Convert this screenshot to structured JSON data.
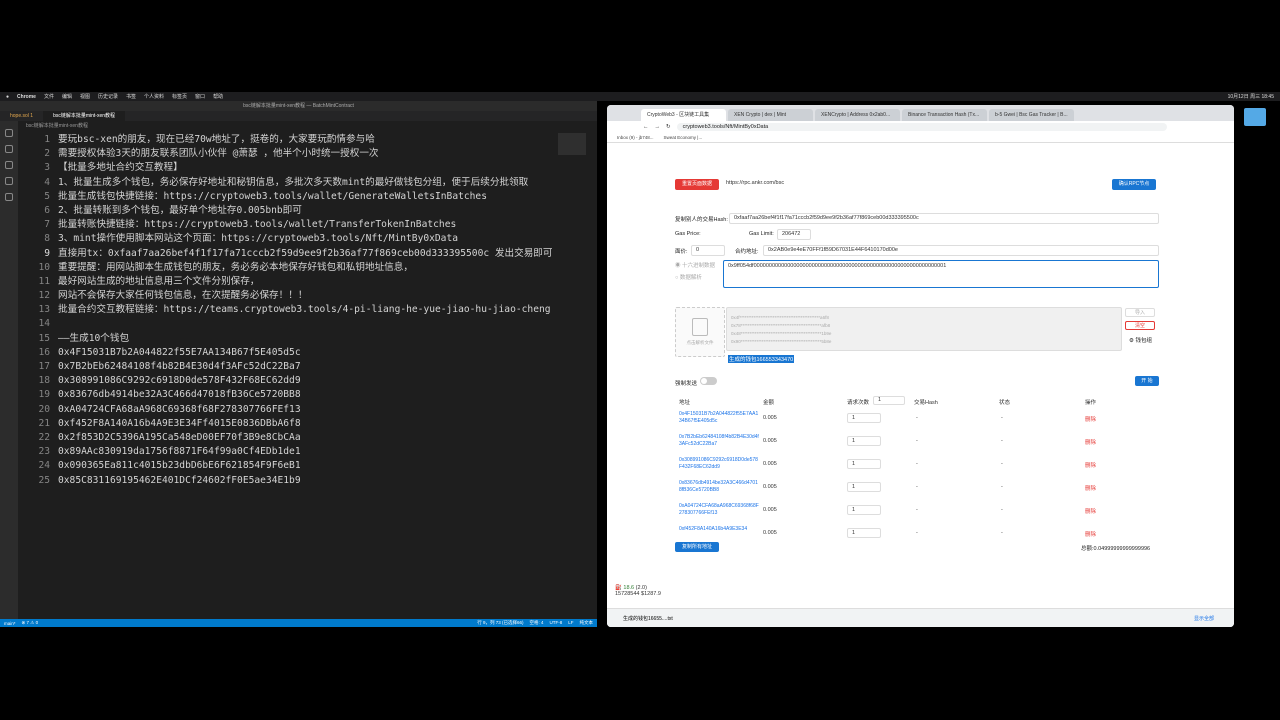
{
  "menubar": {
    "items": [
      "Chrome",
      "文件",
      "编辑",
      "视图",
      "历史记录",
      "书签",
      "个人资料",
      "标签页",
      "窗口",
      "帮助"
    ],
    "clock": "10月12日 周三 18:45"
  },
  "editor": {
    "title": "bsc链解本批量mint-xen教程 — BatchMintContract",
    "tabs": [
      "hope.sol 1",
      "bsc链解本批量mint-xen教程"
    ],
    "breadcrumb": "bsc链解本批量mint-xen教程",
    "lines": [
      "要玩bsc-xen的朋友，现在已经70w地址了，挺卷的，大家要玩酌情参与哈",
      "需要授权体验3天的朋友联系团队小伙伴 @萧瑟 ，他半个小时统一授权一次",
      "【批量多地址合约交互教程】",
      "1、批量生成多个钱包，务必保存好地址和秘钥信息，多批次多天数mint的最好做钱包分组，便于后续分批领取",
      "批量生成钱包快捷链接：https://cryptoweb3.tools/wallet/GenerateWalletsInBatches",
      "2、批量转账到多个钱包，最好单个地址存0.005bnb即可",
      "批量转账快捷链接：https://cryptoweb3.tools/wallet/TransferTokenInBatches",
      "3、mint操作使用脚本网站这个页面：https://cryptoweb3.tools/Nft/MintBy0xData",
      "直接用tx：0xfaaf7aa26bef4f1f17fa71cccb2f59d9ee9f2b36af77f869ceb00d333395500c 发出交易即可",
      "重要提醒：用网站脚本生成钱包的朋友，务必务必本地保存好钱包和私钥地址信息，",
      "最好网站生成的地址信息用三个文件分别保存，",
      "网站不会保存大家任何钱包信息，在次提醒务必保存！！！",
      "批量合约交互教程链接：https://teams.cryptoweb3.tools/4-pi-liang-he-yue-jiao-hu-jiao-cheng",
      "",
      "——生成10个钱包",
      "0x4F15031B7b2A044822f55E7AA134B67f5E405d5c",
      "0x7B2bEb62484108f4b82B4E30d4f3AFc52dC22Ba7",
      "0x308991086C9292c6918D0de578F432F68EC62dd9",
      "0x83676db4914be32A3C466d47018fB36Ce5720BB8",
      "0xA04724CFA68aA968C69368f68F278307766FEf13",
      "0xf452F8A140A16b4A9E3E34Ff4015E0836DBbA6f8",
      "0x2f853D2C5396A195Ca548eD00EF70f3B9e8CbCAa",
      "0x89AAc830919da1756f8871F64f99a0Cf4EDb1de1",
      "0x090365Ea811c4015b23dbD6bE6F621854F9F6eB1",
      "0x85C831169195462E401DCf24602fF0E5ae34E1b9"
    ],
    "status": {
      "branch": "main*",
      "problems": "⊗ 7 ⚠ 0",
      "cursor": "行 9，列 73 (已选择66)",
      "spaces": "空格: 4",
      "encoding": "UTF-8",
      "eol": "LF",
      "lang": "纯文本"
    }
  },
  "browser": {
    "tabs": [
      "CryptoWeb3 - 区块链工具集",
      "XEN Crypto | dex | Mint",
      "XENCrypto | Address 0x2ab0...",
      "Binance Transaction Hash (Tx...",
      "b-5 Gwei | Bsc Gas Tracker | B..."
    ],
    "url": "cryptoweb3.tools/Nft/MintBy0xData",
    "bookmarks": [
      "Inbox (9) - jb748...",
      "Sweat Economy |..."
    ],
    "form": {
      "reset_btn": "重置页面数据",
      "rpc_value": "https://rpc.ankr.com/bsc",
      "rpc_btn": "确认RPC节点",
      "copy_tx_label": "复制别人的交易Hash:",
      "copy_tx_value": "0xfaaf7aa26bef4f1f17fa71cccb2f59d9ee9f2b36af77f869ceb00d333395500c",
      "gas_price_label": "Gas Price:",
      "gas_price_value": "",
      "gas_limit_label": "Gas Limit:",
      "gas_limit_value": "206472",
      "value_label": "面价:",
      "value_value": "0",
      "contract_label": "合约地址:",
      "contract_value": "0x2AB0e9e4eE70FFf1fB9D67031E44F6410170d00e",
      "radio_hex": "十六进制数据",
      "radio_mint": "数据解析",
      "data_value": "0x9ff054df000000000000000000000000000000000000000000000000000000000000001",
      "upload_label": "点击解析文件",
      "keys_masked": "0x4f**********************************************a6f8\n0x78**********************************************afb8\n0x48**********************************************1b9e\n0x90**********************************************5b8e",
      "import_btn": "导入",
      "clear_btn": "清空",
      "wallet_btn": "钱包组",
      "generated_label": "生成的钱包166553343470",
      "force_label": "强制发送",
      "add_btn": "开 始",
      "columns": [
        "地址",
        "金额",
        "请求次数",
        "交易Hash",
        "状态",
        "操作"
      ],
      "count_default": "1",
      "rows": [
        {
          "address": "0x4F15031B7b2A044822f55E7AA134B67f5E405d5c",
          "amount": "0.005",
          "count": "1",
          "hash": "-",
          "status": "-",
          "op": "删除"
        },
        {
          "address": "0x7B2bEb62484108f4b82B4E30d4f3AFc52dC22Ba7",
          "amount": "0.005",
          "count": "1",
          "hash": "-",
          "status": "-",
          "op": "删除"
        },
        {
          "address": "0x308991086C9292c6918D0de578F432F68EC62dd9",
          "amount": "0.005",
          "count": "1",
          "hash": "-",
          "status": "-",
          "op": "删除"
        },
        {
          "address": "0x83676db4914be32A3C466d47018fB36Ce5720BB8",
          "amount": "0.005",
          "count": "1",
          "hash": "-",
          "status": "-",
          "op": "删除"
        },
        {
          "address": "0xA04724CFA68aA968C69368f68F278307766FEf13",
          "amount": "0.005",
          "count": "1",
          "hash": "-",
          "status": "-",
          "op": "删除"
        },
        {
          "address": "0xf452F8A140A16b4A9E3E34",
          "amount": "0.005",
          "count": "1",
          "hash": "-",
          "status": "-",
          "op": "删除"
        }
      ],
      "copy_addr_btn": "复制所有地址",
      "total": "总额:0.04999999999999996"
    },
    "bsc_widget": {
      "gwei": "18.6",
      "sub": "(2.0)",
      "block": "15728544",
      "price": "$1287.9"
    },
    "download": {
      "file": "生成的钱包16655....txt",
      "show_all": "显示全部"
    }
  },
  "colors": {
    "red": "#e53935",
    "blue": "#1976d2",
    "vscode_blue": "#007acc"
  }
}
